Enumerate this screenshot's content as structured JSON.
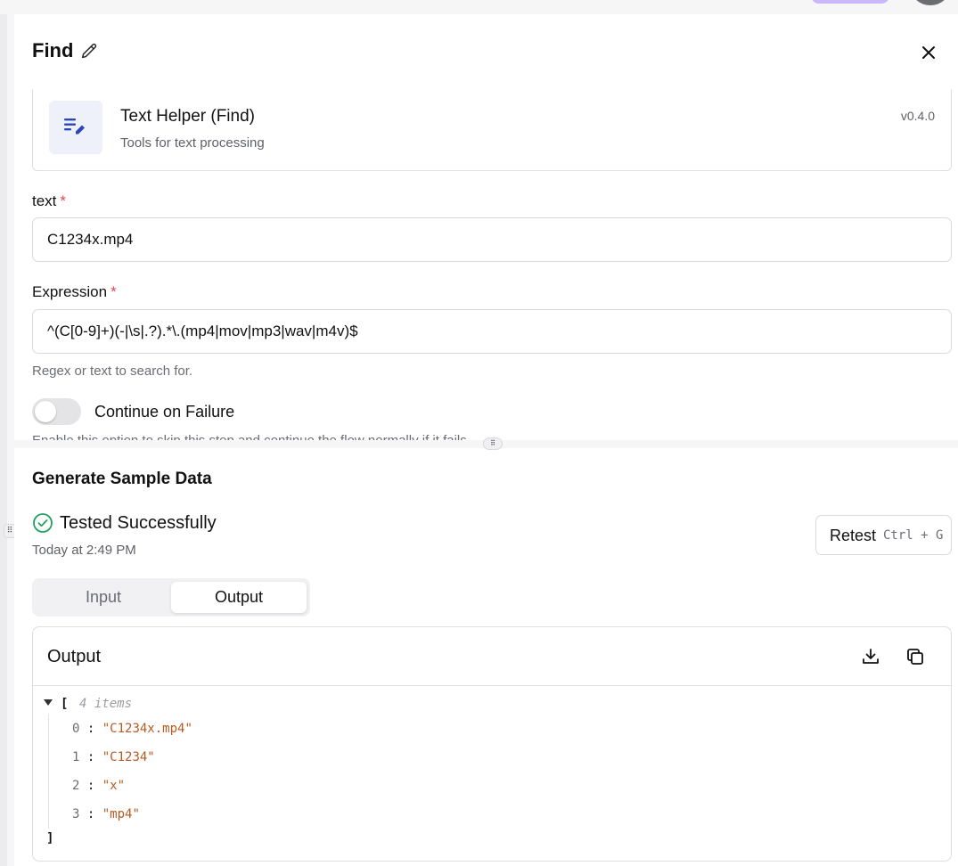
{
  "header": {
    "title": "Find"
  },
  "piece": {
    "name": "Text Helper (Find)",
    "description": "Tools for text processing",
    "version": "v0.4.0"
  },
  "fields": {
    "text": {
      "label": "text",
      "required_mark": "*",
      "value": "C1234x.mp4"
    },
    "expression": {
      "label": "Expression",
      "required_mark": "*",
      "value": "^(C[0-9]+)(-|\\s|.?).*\\.(mp4|mov|mp3|wav|m4v)$",
      "help": "Regex or text to search for."
    },
    "continue_on_failure": {
      "label": "Continue on Failure",
      "enabled": false,
      "help": "Enable this option to skip this step and continue the flow normally if it fails."
    }
  },
  "sample": {
    "title": "Generate Sample Data",
    "status": "Tested Successfully",
    "time": "Today at 2:49 PM",
    "retest_label": "Retest",
    "retest_shortcut": "Ctrl + G",
    "tabs": [
      {
        "label": "Input",
        "active": false
      },
      {
        "label": "Output",
        "active": true
      }
    ],
    "output": {
      "title": "Output",
      "open_bracket": "[",
      "close_bracket": "]",
      "count_label": "4 items",
      "items": [
        {
          "index": "0",
          "value": "\"C1234x.mp4\""
        },
        {
          "index": "1",
          "value": "\"C1234\""
        },
        {
          "index": "2",
          "value": "\"x\""
        },
        {
          "index": "3",
          "value": "\"mp4\""
        }
      ]
    }
  },
  "colors": {
    "required": "#e5484d",
    "success": "#22a060",
    "json_string": "#b65a1e",
    "piece_icon": "#2a47b8"
  },
  "icons": [
    "pencil-icon",
    "close-icon",
    "text-helper-icon",
    "check-circle-icon",
    "download-icon",
    "copy-icon",
    "drag-handle-icon"
  ]
}
